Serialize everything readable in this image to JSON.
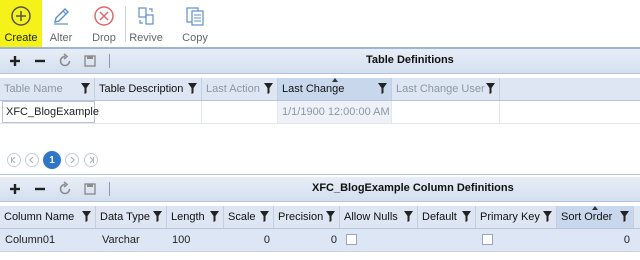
{
  "toolbar": {
    "buttons": [
      {
        "label": "Create",
        "icon": "plus-circle-icon",
        "active": true
      },
      {
        "label": "Alter",
        "icon": "pencil-icon"
      },
      {
        "label": "Drop",
        "icon": "x-circle-icon"
      },
      {
        "label": "Revive",
        "icon": "revive-icon"
      },
      {
        "label": "Copy",
        "icon": "copy-icon"
      }
    ]
  },
  "table_panel": {
    "title": "Table Definitions",
    "actions": [
      "add-icon",
      "remove-icon",
      "refresh-icon",
      "save-icon"
    ],
    "columns": [
      "Table Name",
      "Table Description",
      "Last Action",
      "Last Change",
      "Last Change User"
    ],
    "rows": [
      {
        "table_name": "XFC_BlogExample",
        "table_description": "",
        "last_action": "",
        "last_change": "1/1/1900 12:00:00 AM",
        "last_change_user": ""
      }
    ],
    "pager": {
      "current_page": "1"
    }
  },
  "column_panel": {
    "title": "XFC_BlogExample Column Definitions",
    "actions": [
      "add-icon",
      "remove-icon",
      "refresh-icon",
      "save-icon"
    ],
    "columns": [
      "Column Name",
      "Data Type",
      "Length",
      "Scale",
      "Precision",
      "Allow Nulls",
      "Default",
      "Primary Key",
      "Sort Order"
    ],
    "rows": [
      {
        "column_name": "Column01",
        "data_type": "Varchar",
        "length": "100",
        "scale": "0",
        "precision": "0",
        "allow_nulls": false,
        "default": "",
        "primary_key": false,
        "sort_order": "0"
      }
    ]
  },
  "colors": {
    "create_highlight": "#f5f21a",
    "header_blue": "#dde6f2",
    "selected_row": "#dce6f4",
    "pager_current": "#2f76c8"
  }
}
